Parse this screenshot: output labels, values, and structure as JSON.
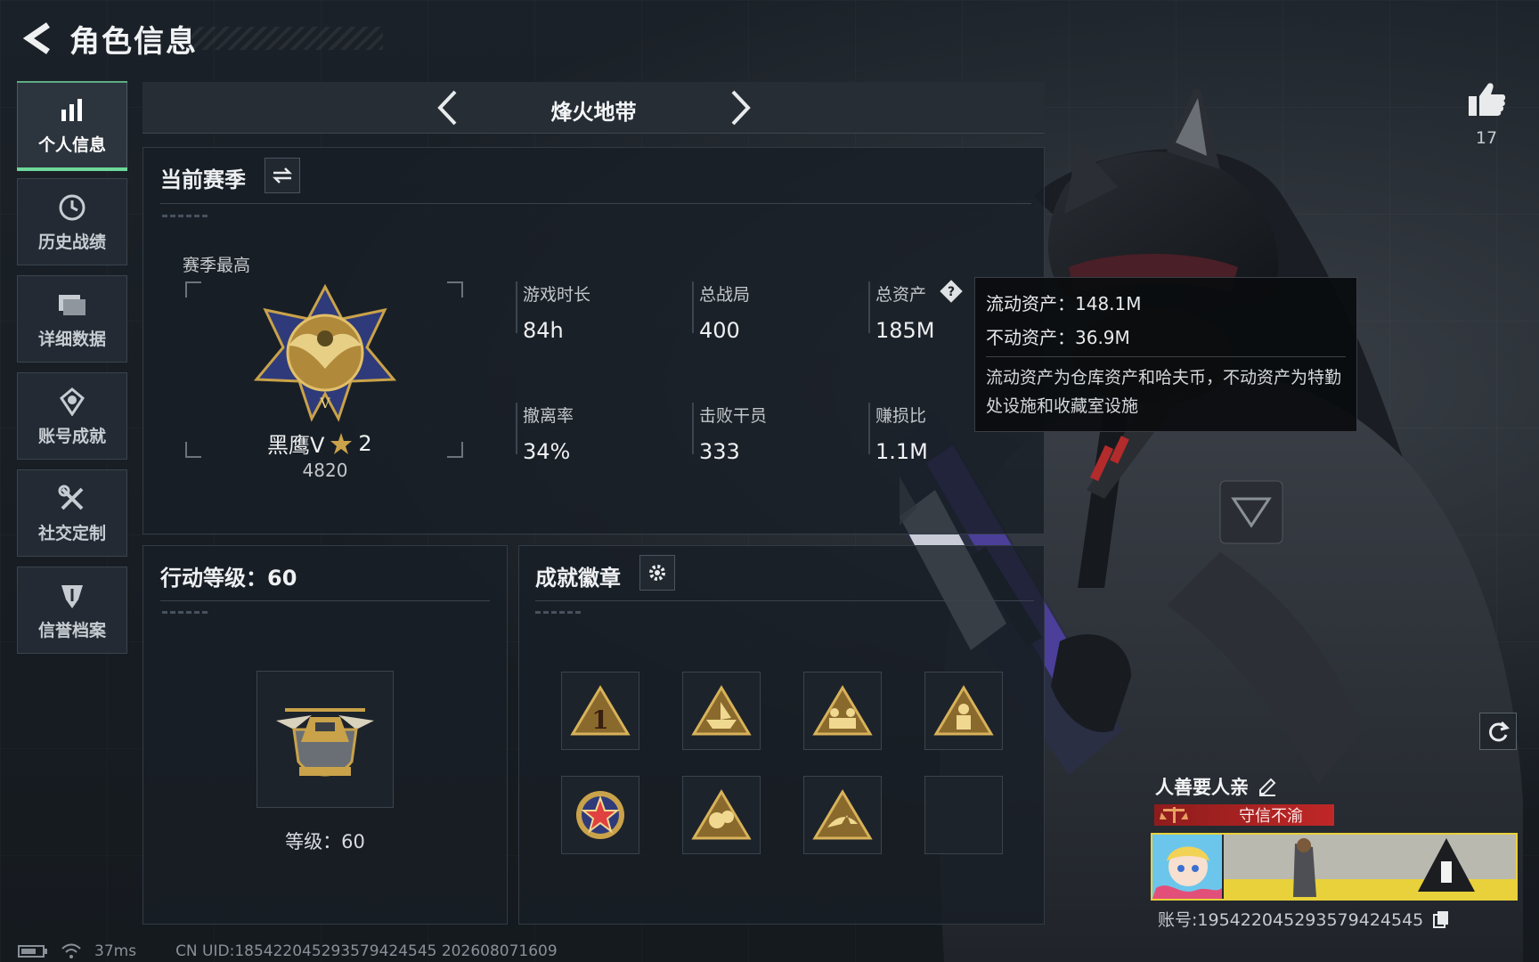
{
  "header": {
    "title": "角色信息"
  },
  "sidebar": {
    "items": [
      {
        "label": "个人信息",
        "icon": "bar-chart-icon",
        "active": true
      },
      {
        "label": "历史战绩",
        "icon": "history-icon",
        "active": false
      },
      {
        "label": "详细数据",
        "icon": "folder-icon",
        "active": false
      },
      {
        "label": "账号成就",
        "icon": "medal-icon",
        "active": false
      },
      {
        "label": "社交定制",
        "icon": "tools-icon",
        "active": false
      },
      {
        "label": "信誉档案",
        "icon": "credit-icon",
        "active": false
      }
    ]
  },
  "mode": {
    "title": "烽火地带"
  },
  "season": {
    "title": "当前赛季",
    "best_label": "赛季最高",
    "rank_name": "黑鹰V",
    "rank_stars": "2",
    "rank_score": "4820",
    "stats": [
      {
        "label": "游戏时长",
        "value": "84h"
      },
      {
        "label": "总战局",
        "value": "400"
      },
      {
        "label": "总资产",
        "value": "185M"
      },
      {
        "label": "撤离率",
        "value": "34%"
      },
      {
        "label": "击败干员",
        "value": "333"
      },
      {
        "label": "赚损比",
        "value": "1.1M"
      }
    ]
  },
  "tooltip": {
    "liquid": "流动资产：148.1M",
    "fixed": "不动资产：36.9M",
    "desc": "流动资产为仓库资产和哈夫币，不动资产为特勤处设施和收藏室设施"
  },
  "action_level": {
    "title": "行动等级：60",
    "level_text": "等级：60"
  },
  "badges": {
    "title": "成就徽章",
    "items": [
      "rank-one-badge-icon",
      "boat-badge-icon",
      "squad-badge-icon",
      "soldier-badge-icon",
      "star-medal-badge-icon",
      "grenade-badge-icon",
      "shark-badge-icon",
      "empty-slot"
    ]
  },
  "profile": {
    "likes": "17",
    "nickname": "人善要人亲",
    "credit_label": "守信不渝",
    "account_id": "账号:1954220452935794245​45"
  },
  "status": {
    "ping": "37ms",
    "uid": "CN UID:18542204529357942​4545 202608071609"
  },
  "colors": {
    "accent": "#6ed79a",
    "gold": "#c9a24a",
    "credit_red": "#b82323",
    "card_border": "#e8d13a"
  }
}
